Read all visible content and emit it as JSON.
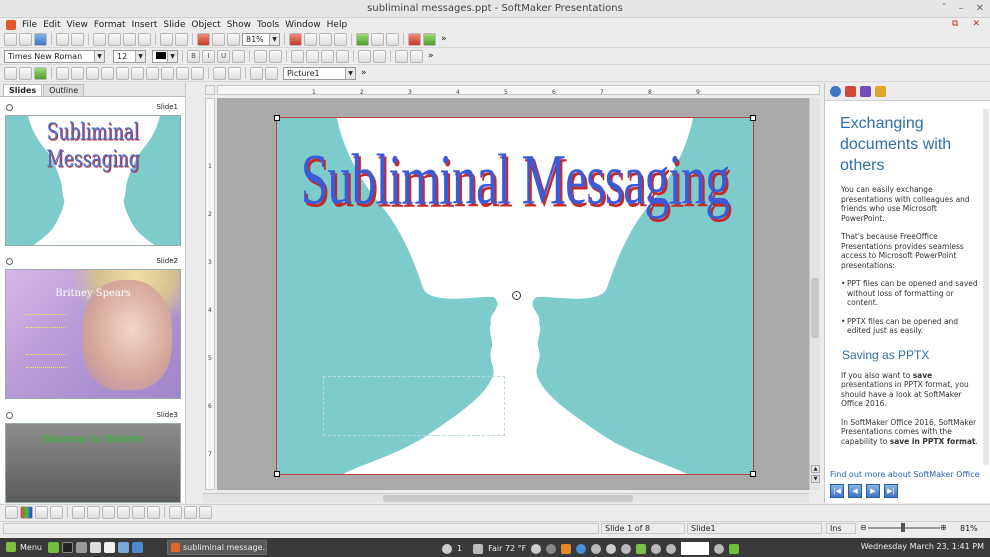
{
  "window": {
    "title": "subliminal messages.ppt - SoftMaker Presentations",
    "controls": [
      "ˆ",
      "–",
      "✕"
    ],
    "mdi_controls": [
      "⧉",
      "✕"
    ]
  },
  "menu": [
    "File",
    "Edit",
    "View",
    "Format",
    "Insert",
    "Slide",
    "Object",
    "Show",
    "Tools",
    "Window",
    "Help"
  ],
  "toolbar": {
    "zoom": "81%",
    "font_name": "Times New Roman",
    "font_size": "12",
    "object_name": "Picture1",
    "more": "»"
  },
  "left_panel": {
    "tabs": [
      "Slides",
      "Outline"
    ],
    "slides": [
      {
        "label": "Slide1",
        "title": "Subliminal Messaging"
      },
      {
        "label": "Slide2",
        "title": "Britney Spears"
      },
      {
        "label": "Slide3",
        "title": "Stairway to Heaven"
      }
    ]
  },
  "ruler": {
    "h_ticks": [
      "1",
      "2",
      "3",
      "4",
      "5",
      "6",
      "7",
      "8",
      "9"
    ],
    "v_ticks": [
      "1",
      "2",
      "3",
      "4",
      "5",
      "6",
      "7"
    ]
  },
  "slide": {
    "title": "Subliminal Messaging",
    "background_color": "#7ecbcb",
    "title_color": "#3c5ad6",
    "title_shadow_color": "#c42a2a"
  },
  "right_panel": {
    "heading": "Exchanging documents with others",
    "para1": "You can easily exchange presentations with colleagues and friends who use Microsoft PowerPoint.",
    "para2": "That's because FreeOffice Presentations provides seamless access to Microsoft PowerPoint presentations:",
    "bullet1": "PPT files can be opened and saved without loss of formatting or content.",
    "bullet2": "PPTX files can be opened and edited just as easily.",
    "heading2": "Saving as PPTX",
    "para3_pre": "If you also want to ",
    "para3_bold": "save",
    "para3_post": " presentations in PPTX format, you should have a look at SoftMaker Office 2016.",
    "para4_pre": "In SoftMaker Office 2016, SoftMaker Presentations comes with the capability to ",
    "para4_bold": "save in PPTX format",
    "para4_post": ".",
    "link": "Find out more about SoftMaker Office",
    "accent_color": "#2e6fa8"
  },
  "status": {
    "slide_of": "Slide 1 of 8",
    "slide_name": "Slide1",
    "mode": "Ins",
    "zoom": "81%"
  },
  "taskbar": {
    "menu_label": "Menu",
    "task_label": "subliminal message...",
    "notif_count": "1",
    "weather": "Fair 72 °F",
    "clock": "Wednesday March 23, 1:41 PM"
  }
}
